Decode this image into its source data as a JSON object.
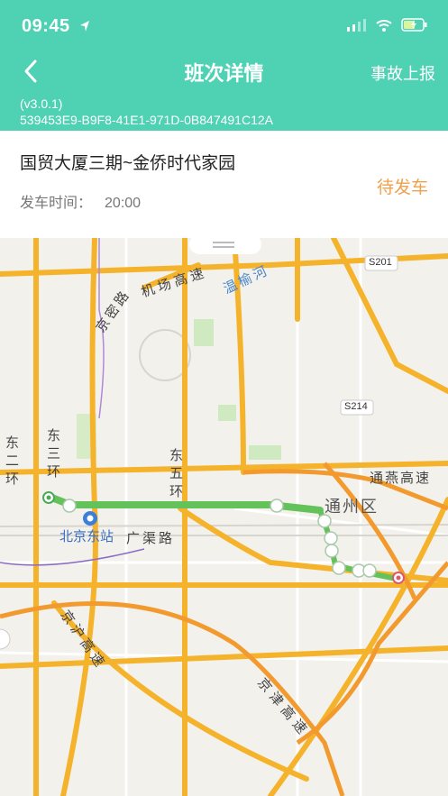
{
  "status_bar": {
    "time": "09:45"
  },
  "header": {
    "title": "班次详情",
    "report_label": "事故上报",
    "version": "(v3.0.1)",
    "device_id": "539453E9-B9F8-41E1-971D-0B847491C12A"
  },
  "trip": {
    "route": "国贸大厦三期~金侨时代家园",
    "departure_label": "发车时间：",
    "departure_time": "20:00",
    "status": "待发车"
  },
  "map": {
    "labels": {
      "s201": "S201",
      "s214": "S214",
      "airport_expressway": "机场高速",
      "jingmi_road": "京密路",
      "wenyu_river": "温榆河",
      "east_2nd_ring": "东二环",
      "east_3rd_ring": "东三环",
      "east_5th_ring": "东五环",
      "tongyan_expressway": "通燕高速",
      "tongzhou_district": "通州区",
      "beijing_east_station": "北京东站",
      "guangqu_road": "广渠路",
      "jinghu_expressway": "京沪高速",
      "jingjin_expressway": "京津高速"
    },
    "colors": {
      "route": "#63c25a",
      "major_road": "#f5b32b",
      "minor_road": "#ffffff"
    }
  }
}
